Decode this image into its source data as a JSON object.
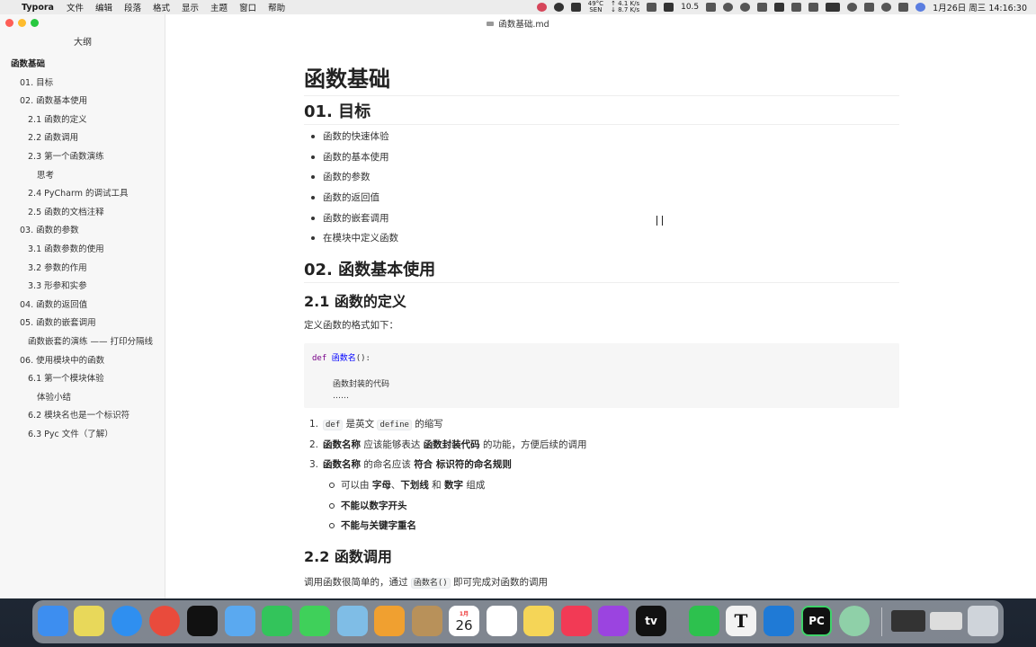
{
  "menubar": {
    "app_name": "Typora",
    "menus": [
      "文件",
      "编辑",
      "段落",
      "格式",
      "显示",
      "主题",
      "窗口",
      "帮助"
    ],
    "cpu_temp": "49°C",
    "cpu_temp_sub": "SEN",
    "net_up": "↑ 4.1 K/s",
    "net_down": "↓ 8.7 K/s",
    "speed": "10.5",
    "date_time": "1月26日 周三 14:16:30"
  },
  "window": {
    "title": "函数基础.md"
  },
  "sidebar": {
    "title": "大纲",
    "items": [
      {
        "label": "函数基础",
        "level": 0
      },
      {
        "label": "01. 目标",
        "level": 1
      },
      {
        "label": "02. 函数基本使用",
        "level": 1
      },
      {
        "label": "2.1 函数的定义",
        "level": 2
      },
      {
        "label": "2.2 函数调用",
        "level": 2
      },
      {
        "label": "2.3 第一个函数演练",
        "level": 2
      },
      {
        "label": "思考",
        "level": 3
      },
      {
        "label": "2.4 PyCharm 的调试工具",
        "level": 2
      },
      {
        "label": "2.5 函数的文档注释",
        "level": 2
      },
      {
        "label": "03. 函数的参数",
        "level": 1
      },
      {
        "label": "3.1 函数参数的使用",
        "level": 2
      },
      {
        "label": "3.2 参数的作用",
        "level": 2
      },
      {
        "label": "3.3 形参和实参",
        "level": 2
      },
      {
        "label": "04. 函数的返回值",
        "level": 1
      },
      {
        "label": "05. 函数的嵌套调用",
        "level": 1
      },
      {
        "label": "函数嵌套的演练 —— 打印分隔线",
        "level": 2
      },
      {
        "label": "06. 使用模块中的函数",
        "level": 1
      },
      {
        "label": "6.1 第一个模块体验",
        "level": 2
      },
      {
        "label": "体验小结",
        "level": 3
      },
      {
        "label": "6.2 模块名也是一个标识符",
        "level": 2
      },
      {
        "label": "6.3 Pyc 文件（了解）",
        "level": 2
      }
    ]
  },
  "doc": {
    "h1": "函数基础",
    "sec1": "01. 目标",
    "goals": [
      "函数的快速体验",
      "函数的基本使用",
      "函数的参数",
      "函数的返回值",
      "函数的嵌套调用",
      "在模块中定义函数"
    ],
    "sec2": "02. 函数基本使用",
    "sub21": "2.1 函数的定义",
    "def_intro": "定义函数的格式如下：",
    "code": {
      "kw": "def",
      "fn": "函数名",
      "paren": "():",
      "body1": "函数封装的代码",
      "body2": "……"
    },
    "ol": {
      "i1_code1": "def",
      "i1_t1": " 是英文 ",
      "i1_code2": "define",
      "i1_t2": " 的缩写",
      "i2_b1": "函数名称",
      "i2_t1": " 应该能够表达 ",
      "i2_b2": "函数封装代码",
      "i2_t2": " 的功能，方便后续的调用",
      "i3_b1": "函数名称",
      "i3_t1": " 的命名应该 ",
      "i3_b2": "符合 标识符的命名规则"
    },
    "subul": {
      "s1_t1": "可以由 ",
      "s1_b1": "字母",
      "s1_t2": "、",
      "s1_b2": "下划线",
      "s1_t3": " 和 ",
      "s1_b3": "数字",
      "s1_t4": " 组成",
      "s2": "不能以数字开头",
      "s3": "不能与关键字重名"
    },
    "sub22": "2.2 函数调用",
    "call_t1": "调用函数很简单的，通过 ",
    "call_code": "函数名()",
    "call_t2": " 即可完成对函数的调用"
  },
  "dock": {
    "calendar_month": "1月",
    "calendar_day": "26",
    "tv_label": "tv",
    "typora_letter": "T",
    "pycharm_letters": "PC"
  }
}
